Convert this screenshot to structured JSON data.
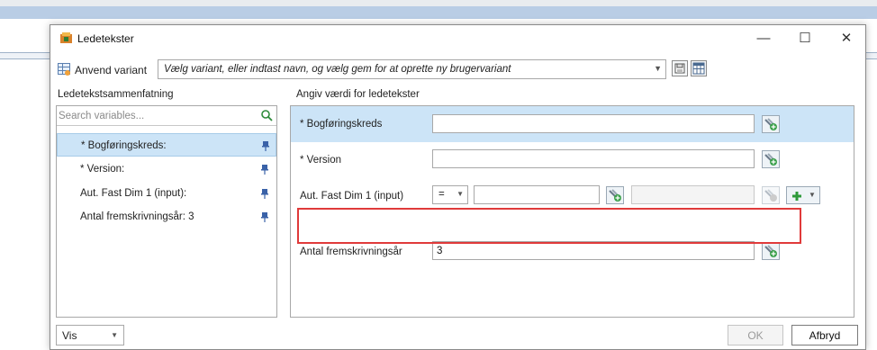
{
  "window": {
    "title": "Ledetekster",
    "minimize_glyph": "—",
    "maximize_glyph": "☐",
    "close_glyph": "✕"
  },
  "variant": {
    "label": "Anvend variant",
    "combo_text": "Vælg variant, eller indtast navn, og vælg gem for at oprette ny brugervariant"
  },
  "left": {
    "heading": "Ledetekstsammenfatning",
    "search_placeholder": "Search variables...",
    "items": [
      {
        "label": "* Bogføringskreds:"
      },
      {
        "label": "* Version:"
      },
      {
        "label": "Aut. Fast Dim 1 (input):"
      },
      {
        "label": "Antal fremskrivningsår: 3"
      }
    ]
  },
  "right": {
    "heading": "Angiv værdi for ledetekster",
    "rows": [
      {
        "label": "* Bogføringskreds",
        "value": ""
      },
      {
        "label": "* Version",
        "value": ""
      },
      {
        "label": "Aut. Fast Dim 1 (input)",
        "operator": "=",
        "value": "",
        "value2": ""
      },
      {
        "label": "Antal fremskrivningsår",
        "value": "3"
      }
    ]
  },
  "footer": {
    "vis_label": "Vis",
    "ok_label": "OK",
    "cancel_label": "Afbryd"
  },
  "colors": {
    "selection": "#cce4f7",
    "highlight": "#e03a3a",
    "background_band": "#b9cde5"
  },
  "icons": [
    "app-icon",
    "variant-icon",
    "save-icon",
    "grid-icon",
    "search-icon",
    "pin-icon",
    "lookup-icon",
    "add-icon",
    "chevron-down-icon"
  ]
}
